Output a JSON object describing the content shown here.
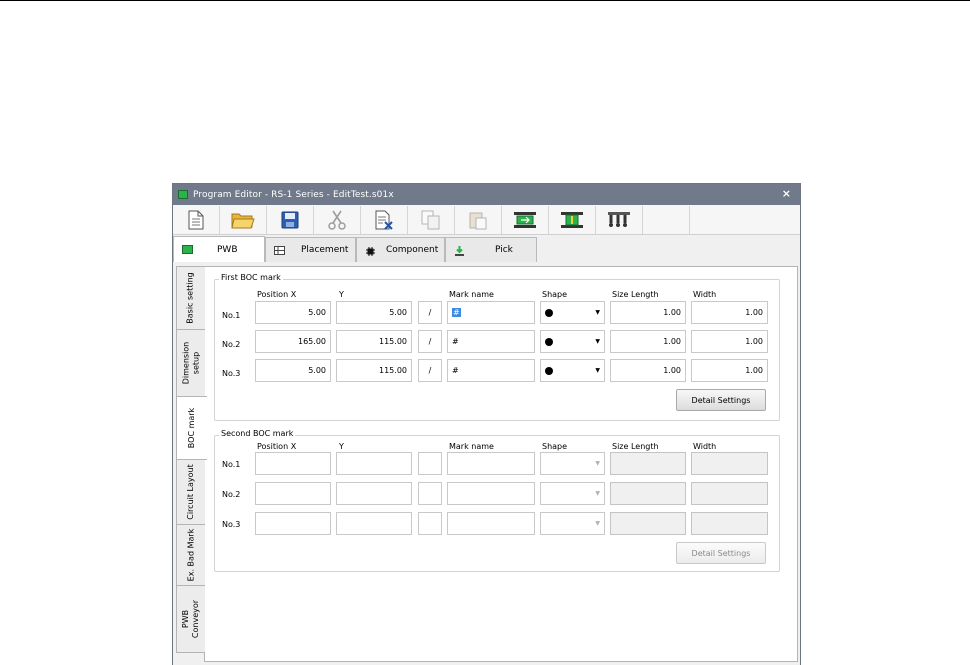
{
  "window": {
    "title": "Program Editor - RS-1 Series - EditTest.s01x",
    "close_label": "×"
  },
  "toolbar": [
    {
      "icon": "new-document-icon",
      "enabled": true
    },
    {
      "icon": "open-folder-icon",
      "enabled": true
    },
    {
      "icon": "save-disk-icon",
      "enabled": true
    },
    {
      "icon": "cut-scissors-icon",
      "enabled": false
    },
    {
      "icon": "delete-document-icon",
      "enabled": true
    },
    {
      "icon": "copy-icon",
      "enabled": false
    },
    {
      "icon": "paste-icon",
      "enabled": false
    },
    {
      "icon": "board-transfer-icon",
      "enabled": true
    },
    {
      "icon": "board-fix-icon",
      "enabled": true
    },
    {
      "icon": "nozzle-icon",
      "enabled": true
    },
    {
      "icon": "blank",
      "enabled": true
    }
  ],
  "top_tabs": [
    {
      "label": "PWB",
      "icon": "pwb-icon",
      "active": true
    },
    {
      "label": "Placement",
      "icon": "placement-grid-icon",
      "active": false
    },
    {
      "label": "Component",
      "icon": "chip-icon",
      "active": false
    },
    {
      "label": "Pick",
      "icon": "pick-arrow-icon",
      "active": false
    }
  ],
  "side_tabs": [
    {
      "label": "Basic setting",
      "active": false
    },
    {
      "label": "Dimension setup",
      "active": false
    },
    {
      "label": "BOC mark",
      "active": true
    },
    {
      "label": "Circuit Layout",
      "active": false
    },
    {
      "label": "Ex. Bad Mark",
      "active": false
    },
    {
      "label": "PWB Conveyor",
      "active": false
    }
  ],
  "headers": {
    "position_x": "Position X",
    "y": "Y",
    "mark_name": "Mark name",
    "shape": "Shape",
    "size_length": "Size Length",
    "width": "Width"
  },
  "first": {
    "title": "First BOC mark",
    "rows": [
      {
        "label": "No.1",
        "x": "5.00",
        "y": "5.00",
        "slash": "/",
        "mark": "#",
        "shape": "●",
        "length": "1.00",
        "width": "1.00"
      },
      {
        "label": "No.2",
        "x": "165.00",
        "y": "115.00",
        "slash": "/",
        "mark": "#",
        "shape": "●",
        "length": "1.00",
        "width": "1.00"
      },
      {
        "label": "No.3",
        "x": "5.00",
        "y": "115.00",
        "slash": "/",
        "mark": "#",
        "shape": "●",
        "length": "1.00",
        "width": "1.00"
      }
    ],
    "button": "Detail Settings"
  },
  "second": {
    "title": "Second BOC mark",
    "rows": [
      {
        "label": "No.1"
      },
      {
        "label": "No.2"
      },
      {
        "label": "No.3"
      }
    ],
    "button": "Detail Settings"
  },
  "colors": {
    "titlebar": "#707a8a",
    "accent_green": "#2bb24a",
    "selection": "#3d8be0"
  }
}
